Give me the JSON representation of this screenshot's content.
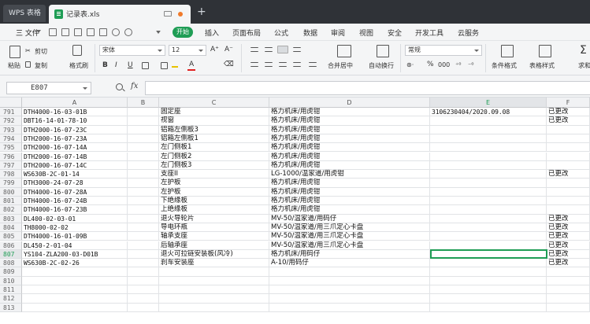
{
  "titlebar": {
    "app_tab": "WPS 表格",
    "doc_title": "记录表.xls",
    "new_tab": "+"
  },
  "menubar": {
    "file": "三 文件",
    "start": "开始",
    "items": [
      "插入",
      "页面布局",
      "公式",
      "数据",
      "审阅",
      "视图",
      "安全",
      "开发工具",
      "云服务"
    ]
  },
  "ribbon": {
    "cut": "剪切",
    "paste": "粘贴",
    "copy": "复制",
    "format_painter": "格式刷",
    "font_name": "宋体",
    "font_size": "12",
    "grow_font": "A⁺",
    "shrink_font": "A⁻",
    "bold": "B",
    "italic": "I",
    "underline": "U",
    "merge_center": "合并居中",
    "wrap": "自动换行",
    "number_format": "常规",
    "percent": "%",
    "thousands": "000",
    "cond_format": "条件格式",
    "table_style": "表格样式",
    "sum": "求和"
  },
  "formula_bar": {
    "name_box": "E807",
    "fx": "fx",
    "formula": ""
  },
  "sheet": {
    "columns": [
      "A",
      "B",
      "C",
      "D",
      "E",
      "F"
    ],
    "active_col": "E",
    "active_row": "807",
    "rows": [
      {
        "n": "791",
        "a": "DTH4000-16-03-01B",
        "c": "固定座",
        "d": "格力机床/用虎钳",
        "e": "3106230404/2020.09.08",
        "f": "已更改"
      },
      {
        "n": "792",
        "a": "DBT16-14-01-78-10",
        "c": "视窗",
        "d": "格力机床/用虎钳",
        "e": "",
        "f": "已更改"
      },
      {
        "n": "793",
        "a": "DTH2000-16-07-23C",
        "c": "铝箱左侧板3",
        "d": "格力机床/用虎钳",
        "e": "",
        "f": ""
      },
      {
        "n": "794",
        "a": "DTH2000-16-07-23A",
        "c": "铝箱左侧板1",
        "d": "格力机床/用虎钳",
        "e": "",
        "f": ""
      },
      {
        "n": "795",
        "a": "DTH2000-16-07-14A",
        "c": "左门侧板1",
        "d": "格力机床/用虎钳",
        "e": "",
        "f": ""
      },
      {
        "n": "796",
        "a": "DTH2000-16-07-14B",
        "c": "左门侧板2",
        "d": "格力机床/用虎钳",
        "e": "",
        "f": ""
      },
      {
        "n": "797",
        "a": "DTH2000-16-07-14C",
        "c": "左门侧板3",
        "d": "格力机床/用虎钳",
        "e": "",
        "f": ""
      },
      {
        "n": "798",
        "a": "WS630B-2C-01-14",
        "c": "支座II",
        "d": "LG-1000/温家道/用虎钳",
        "e": "",
        "f": "已更改"
      },
      {
        "n": "799",
        "a": "DTH3000-24-07-28",
        "c": "左护板",
        "d": "格力机床/用虎钳",
        "e": "",
        "f": ""
      },
      {
        "n": "800",
        "a": "DTH4000-16-07-28A",
        "c": "左护板",
        "d": "格力机床/用虎钳",
        "e": "",
        "f": ""
      },
      {
        "n": "801",
        "a": "DTH4000-16-07-24B",
        "c": "下绝缘板",
        "d": "格力机床/用虎钳",
        "e": "",
        "f": ""
      },
      {
        "n": "802",
        "a": "DTH4000-16-07-23B",
        "c": "上绝缘板",
        "d": "格力机床/用虎钳",
        "e": "",
        "f": ""
      },
      {
        "n": "803",
        "a": "DL400-02-03-01",
        "c": "退火导轮片",
        "d": "MV-50/温家道/用码仔",
        "e": "",
        "f": "已更改"
      },
      {
        "n": "804",
        "a": "TH8000-02-02",
        "c": "导电环瓶",
        "d": "MV-50/温家道/用三爪定心卡盘",
        "e": "",
        "f": "已更改"
      },
      {
        "n": "805",
        "a": "DTH4000-16-01-09B",
        "c": "轴承支座",
        "d": "MV-50/温家道/用三爪定心卡盘",
        "e": "",
        "f": "已更改"
      },
      {
        "n": "806",
        "a": "DL450-2-01-04",
        "c": "后轴承座",
        "d": "MV-50/温家道/用三爪定心卡盘",
        "e": "",
        "f": "已更改"
      },
      {
        "n": "807",
        "a": "YS104-ZLA200-03-D01B",
        "c": "退火可拉链安装板(风冷)",
        "d": "格力机床/用码仔",
        "e": "",
        "f": "已更改"
      },
      {
        "n": "808",
        "a": "WS630B-2C-02-26",
        "c": "刹车安装座",
        "d": "A-10/用码仔",
        "e": "",
        "f": "已更改"
      },
      {
        "n": "809",
        "a": "",
        "c": "",
        "d": "",
        "e": "",
        "f": ""
      },
      {
        "n": "810",
        "a": "",
        "c": "",
        "d": "",
        "e": "",
        "f": ""
      },
      {
        "n": "811",
        "a": "",
        "c": "",
        "d": "",
        "e": "",
        "f": ""
      },
      {
        "n": "812",
        "a": "",
        "c": "",
        "d": "",
        "e": "",
        "f": ""
      },
      {
        "n": "813",
        "a": "",
        "c": "",
        "d": "",
        "e": "",
        "f": ""
      }
    ]
  },
  "colors": {
    "accent": "#1f9d55",
    "titlebar": "#2f3237",
    "ribbon_bg": "#f4f5f6"
  }
}
